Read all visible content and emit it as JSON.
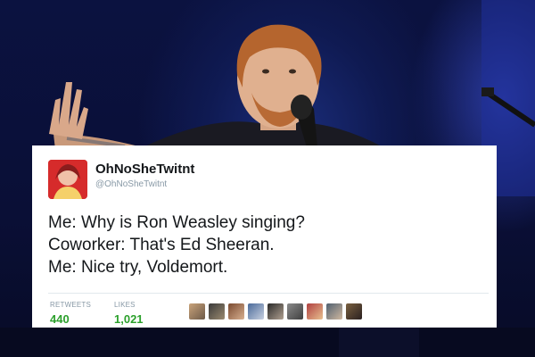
{
  "tweet": {
    "display_name": "OhNoSheTwitnt",
    "handle": "@OhNoSheTwitnt",
    "lines": [
      "Me: Why is Ron Weasley singing?",
      "Coworker: That's Ed Sheeran.",
      "Me: Nice try, Voldemort."
    ],
    "stats": {
      "retweets_label": "RETWEETS",
      "retweets_value": "440",
      "likes_label": "LIKES",
      "likes_value": "1,021"
    }
  },
  "colors": {
    "stat_value": "#2ca02c",
    "avatar": "#d62b2b",
    "background": "#0a1030"
  }
}
